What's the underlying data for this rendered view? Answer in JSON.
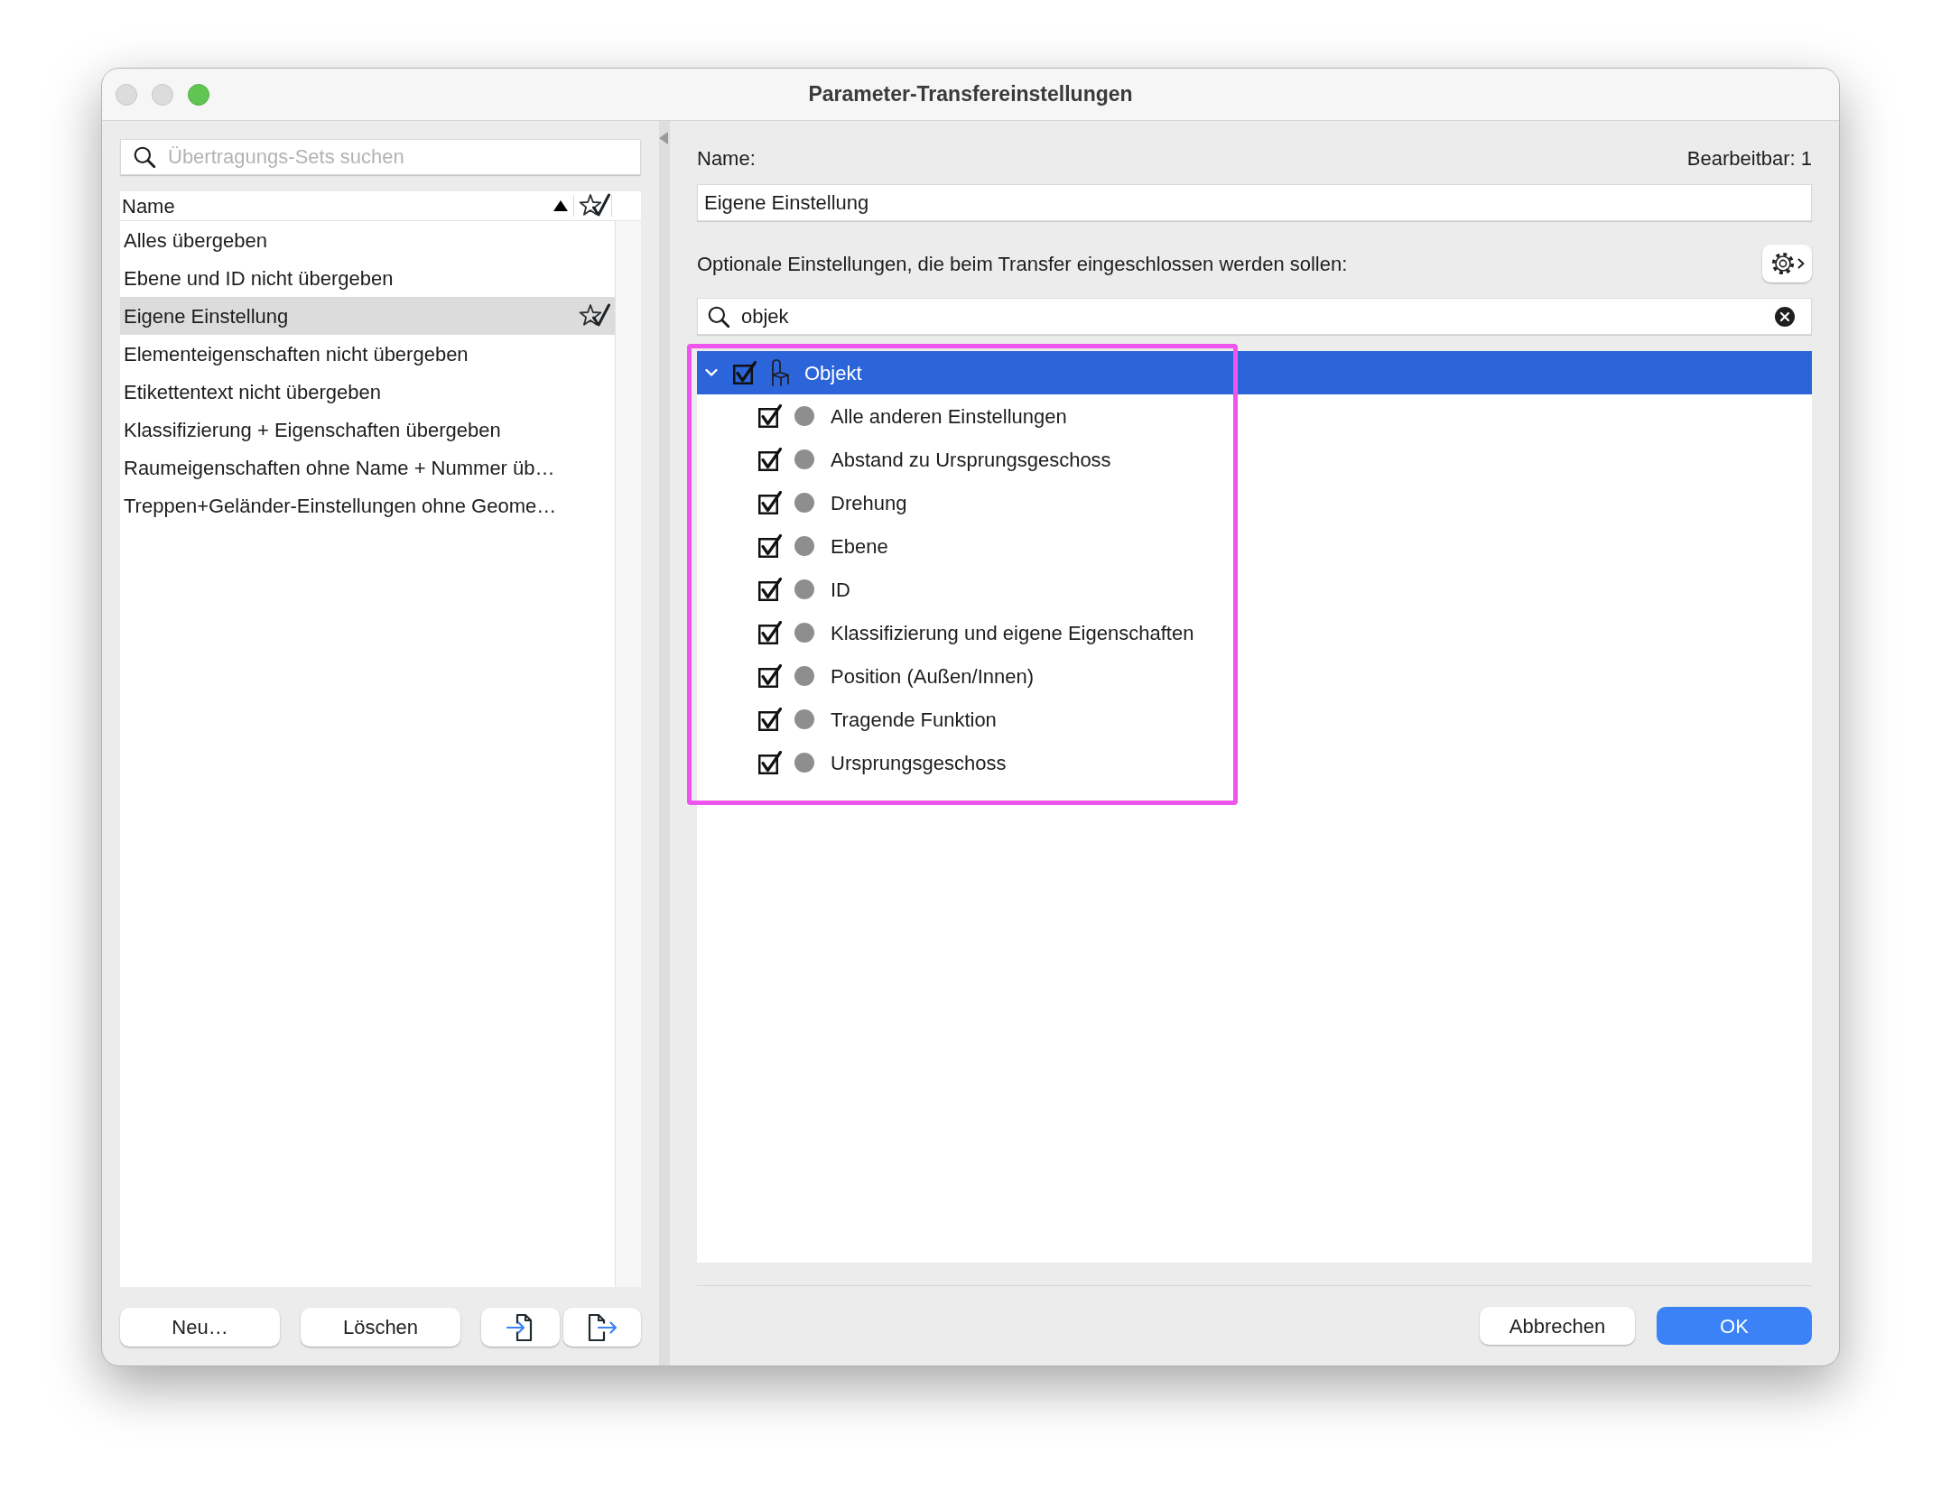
{
  "window": {
    "title": "Parameter-Transfereinstellungen",
    "controls": [
      {
        "kind": "close",
        "enabled": false
      },
      {
        "kind": "minimize",
        "enabled": false
      },
      {
        "kind": "zoom",
        "enabled": true
      }
    ]
  },
  "sets_panel": {
    "search": {
      "placeholder": "Übertragungs-Sets suchen"
    },
    "list": {
      "column": "Name",
      "sort_ascending": true,
      "items": [
        {
          "label": "Alles übergeben",
          "selected": false,
          "starred": false
        },
        {
          "label": "Ebene und ID nicht übergeben",
          "selected": false,
          "starred": false
        },
        {
          "label": "Eigene Einstellung",
          "selected": true,
          "starred": true
        },
        {
          "label": "Elementeigenschaften nicht übergeben",
          "selected": false,
          "starred": false
        },
        {
          "label": "Etikettentext nicht übergeben",
          "selected": false,
          "starred": false
        },
        {
          "label": "Klassifizierung + Eigenschaften übergeben",
          "selected": false,
          "starred": false
        },
        {
          "label": "Raumeigenschaften ohne Name + Nummer üb…",
          "selected": false,
          "starred": false
        },
        {
          "label": "Treppen+Geländer-Einstellungen ohne Geome…",
          "selected": false,
          "starred": false
        }
      ]
    },
    "buttons": [
      {
        "kind": "text",
        "label": "Neu…"
      },
      {
        "kind": "text",
        "label": "Löschen"
      },
      {
        "kind": "import"
      },
      {
        "kind": "export"
      }
    ]
  },
  "settings_panel": {
    "name_label": "Name:",
    "editable_count": "Bearbeitbar: 1",
    "name_value": "Eigene Einstellung",
    "options_label": "Optionale Einstellungen, die beim Transfer eingeschlossen werden sollen:",
    "filter": {
      "value": "objek"
    },
    "tree": {
      "highlighted": true,
      "items": [
        {
          "label": "Objekt",
          "selected": true,
          "expanded": true,
          "checked": true,
          "children": [
            {
              "label": "Alle anderen Einstellungen",
              "selected": false,
              "checked": true
            },
            {
              "label": "Abstand zu Ursprungsgeschoss",
              "selected": false,
              "checked": true
            },
            {
              "label": "Drehung",
              "selected": false,
              "checked": true
            },
            {
              "label": "Ebene",
              "selected": false,
              "checked": true
            },
            {
              "label": "ID",
              "selected": false,
              "checked": true
            },
            {
              "label": "Klassifizierung und eigene Eigenschaften",
              "selected": false,
              "checked": true
            },
            {
              "label": "Position (Außen/Innen)",
              "selected": false,
              "checked": true
            },
            {
              "label": "Tragende Funktion",
              "selected": false,
              "checked": true
            },
            {
              "label": "Ursprungsgeschoss",
              "selected": false,
              "checked": true
            }
          ]
        }
      ]
    }
  },
  "footer_buttons": [
    {
      "label": "Abbrechen",
      "primary": false
    },
    {
      "label": "OK",
      "primary": true
    }
  ]
}
